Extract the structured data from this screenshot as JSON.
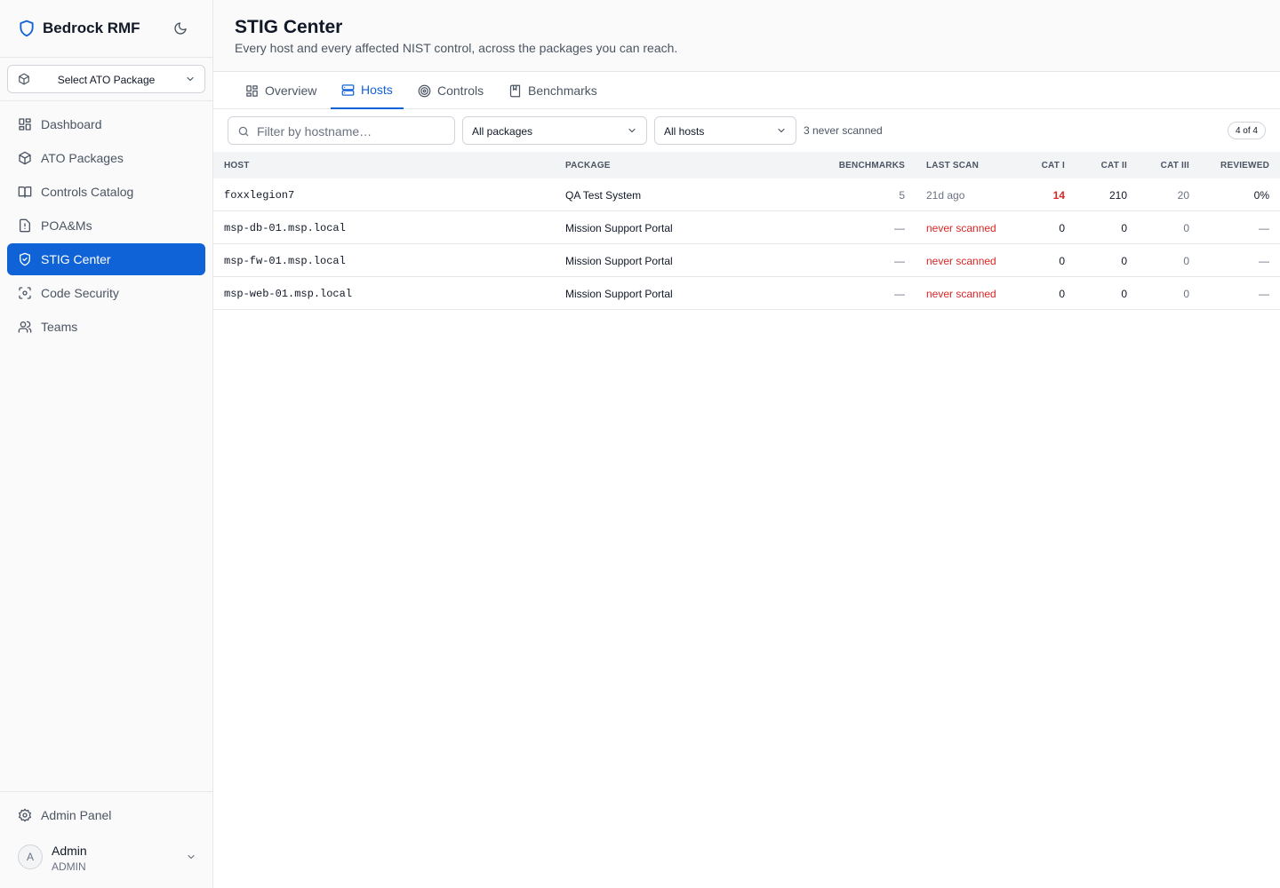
{
  "app": {
    "brand": "Bedrock RMF",
    "package_select": "Select ATO Package"
  },
  "sidebar": {
    "items": [
      {
        "label": "Dashboard",
        "icon": "dashboard-icon"
      },
      {
        "label": "ATO Packages",
        "icon": "package-icon"
      },
      {
        "label": "Controls Catalog",
        "icon": "book-icon"
      },
      {
        "label": "POA&Ms",
        "icon": "file-alert-icon"
      },
      {
        "label": "STIG Center",
        "icon": "shield-check-icon",
        "active": true
      },
      {
        "label": "Code Security",
        "icon": "scan-icon"
      },
      {
        "label": "Teams",
        "icon": "users-icon"
      }
    ],
    "admin_panel": "Admin Panel",
    "user": {
      "initial": "A",
      "name": "Admin",
      "role": "ADMIN"
    }
  },
  "page": {
    "title": "STIG Center",
    "subtitle": "Every host and every affected NIST control, across the packages you can reach."
  },
  "tabs": [
    {
      "label": "Overview",
      "icon": "overview-icon"
    },
    {
      "label": "Hosts",
      "icon": "server-icon",
      "active": true
    },
    {
      "label": "Controls",
      "icon": "target-icon"
    },
    {
      "label": "Benchmarks",
      "icon": "bookmark-book-icon"
    }
  ],
  "filters": {
    "search_placeholder": "Filter by hostname…",
    "packages": "All packages",
    "hosts": "All hosts",
    "never_scanned": "3 never scanned",
    "count": "4 of 4"
  },
  "table": {
    "headers": {
      "host": "HOST",
      "package": "PACKAGE",
      "benchmarks": "BENCHMARKS",
      "last_scan": "LAST SCAN",
      "cat1": "CAT I",
      "cat2": "CAT II",
      "cat3": "CAT III",
      "reviewed": "REVIEWED"
    },
    "rows": [
      {
        "host": "foxxlegion7",
        "package": "QA Test System",
        "benchmarks": "5",
        "last_scan": "21d ago",
        "cat1": "14",
        "cat2": "210",
        "cat3": "20",
        "reviewed": "0%"
      },
      {
        "host": "msp-db-01.msp.local",
        "package": "Mission Support Portal",
        "benchmarks": "—",
        "last_scan": "never scanned",
        "cat1": "0",
        "cat2": "0",
        "cat3": "0",
        "reviewed": "—"
      },
      {
        "host": "msp-fw-01.msp.local",
        "package": "Mission Support Portal",
        "benchmarks": "—",
        "last_scan": "never scanned",
        "cat1": "0",
        "cat2": "0",
        "cat3": "0",
        "reviewed": "—"
      },
      {
        "host": "msp-web-01.msp.local",
        "package": "Mission Support Portal",
        "benchmarks": "—",
        "last_scan": "never scanned",
        "cat1": "0",
        "cat2": "0",
        "cat3": "0",
        "reviewed": "—"
      }
    ]
  },
  "colors": {
    "accent": "#1062d7",
    "danger": "#dc2626"
  }
}
